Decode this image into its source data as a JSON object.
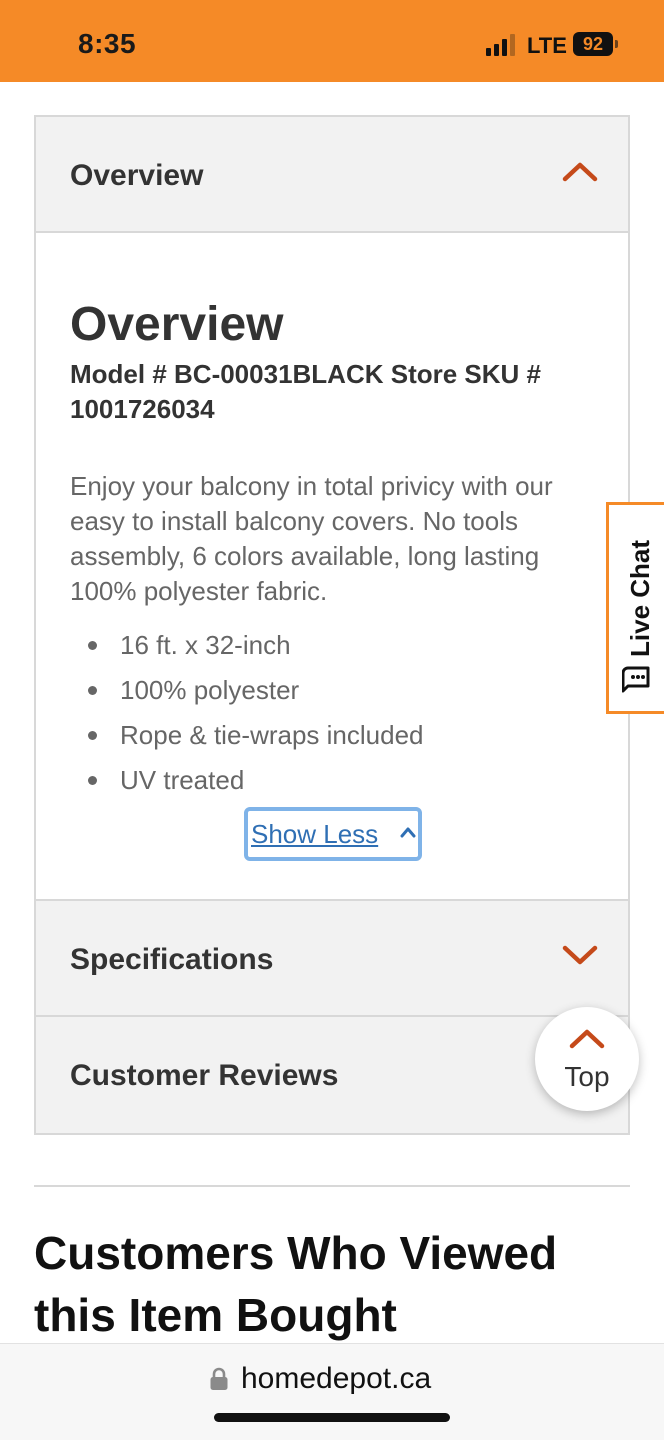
{
  "status_bar": {
    "time": "8:35",
    "network": "LTE",
    "battery": "92"
  },
  "accordion": {
    "overview_header": "Overview",
    "specifications_header": "Specifications",
    "reviews_header": "Customer Reviews"
  },
  "overview": {
    "title": "Overview",
    "model_line": "Model # BC-00031BLACK Store SKU # 1001726034",
    "description": "Enjoy your balcony in total privicy with our easy to install balcony covers. No tools assembly, 6 colors available, long lasting 100% polyester fabric.",
    "bullets": [
      "16 ft. x 32-inch",
      "100% polyester",
      "Rope & tie-wraps included",
      "UV treated"
    ],
    "show_less_label": "Show Less"
  },
  "live_chat_label": "Live Chat",
  "top_button_label": "Top",
  "section_title": "Customers Who Viewed this Item Bought",
  "url_bar": {
    "domain": "homedepot.ca"
  },
  "colors": {
    "brand_orange": "#f58a27",
    "chevron": "#c54a1a",
    "link_blue": "#2f6fb4",
    "focus_ring": "#7fb3e8"
  }
}
